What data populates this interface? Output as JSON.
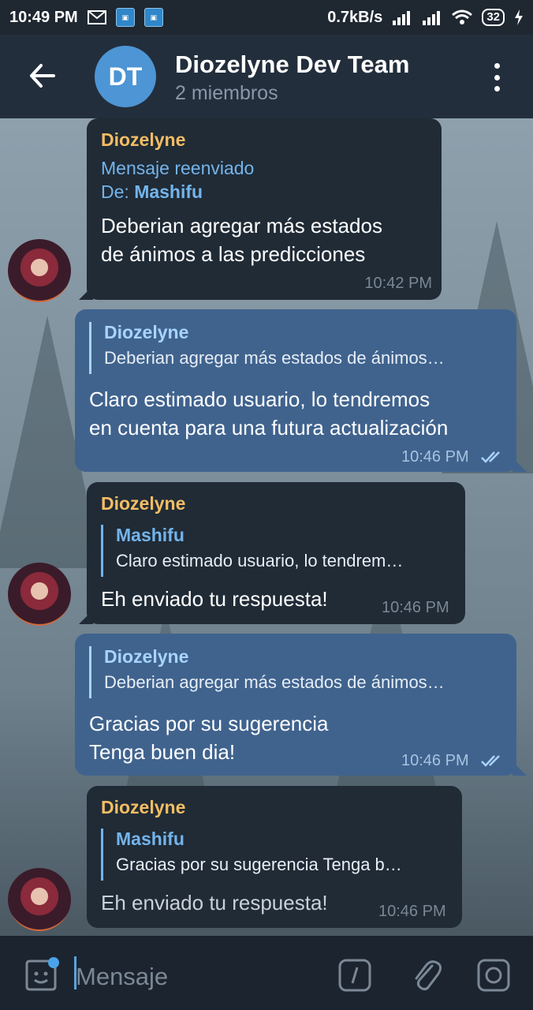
{
  "status_bar": {
    "time": "10:49 PM",
    "speed": "0.7kB/s",
    "battery": "32"
  },
  "header": {
    "avatar_initials": "DT",
    "title": "Diozelyne Dev Team",
    "subtitle": "2 miembros"
  },
  "messages": [
    {
      "direction": "incoming",
      "sender": "Diozelyne",
      "forward_label": "Mensaje reenviado",
      "forward_from_prefix": "De: ",
      "forward_from": "Mashifu",
      "lines": [
        "Deberian agregar más estados",
        "de ánimos a las predicciones"
      ],
      "time": "10:42 PM"
    },
    {
      "direction": "outgoing",
      "reply_name": "Diozelyne",
      "reply_text": "Deberian agregar más estados de ánimos…",
      "lines": [
        "Claro estimado usuario, lo tendremos",
        "en cuenta para una futura actualización"
      ],
      "time": "10:46 PM"
    },
    {
      "direction": "incoming",
      "sender": "Diozelyne",
      "reply_name": "Mashifu",
      "reply_text": "Claro estimado usuario, lo tendrem…",
      "lines": [
        "Eh enviado tu respuesta!"
      ],
      "time": "10:46 PM"
    },
    {
      "direction": "outgoing",
      "reply_name": "Diozelyne",
      "reply_text": "Deberian agregar más estados de ánimos…",
      "lines": [
        "Gracias por su sugerencia",
        "Tenga buen dia!"
      ],
      "time": "10:46 PM"
    },
    {
      "direction": "incoming",
      "sender": "Diozelyne",
      "reply_name": "Mashifu",
      "reply_text": "Gracias por su sugerencia Tenga b…",
      "lines": [
        "Eh enviado tu respuesta!"
      ],
      "time": "10:46 PM"
    }
  ],
  "input": {
    "placeholder": "Mensaje"
  },
  "colors": {
    "header_bg": "#232e3c",
    "incoming_bubble": "#202b36",
    "outgoing_bubble": "#40638e",
    "sender_name": "#f5bd64",
    "link_blue": "#74b4eb"
  }
}
